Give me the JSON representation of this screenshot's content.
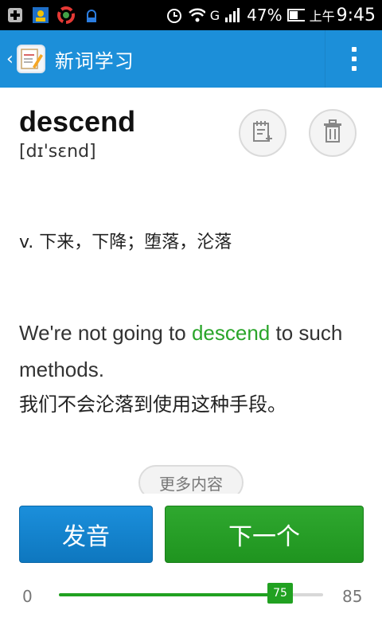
{
  "status_bar": {
    "battery": "47%",
    "time_prefix": "上午",
    "time": "9:45",
    "network": "G"
  },
  "app_bar": {
    "title": "新词学习",
    "color": "#1c8fd9"
  },
  "word": {
    "text": "descend",
    "phonetic": "[dɪ'sɛnd]",
    "definition": "v. 下来，下降；堕落，沦落"
  },
  "example": {
    "before": "We're not going to ",
    "highlight": "descend",
    "after": " to such methods.",
    "translation": "我们不会沦落到使用这种手段。"
  },
  "more_label": "更多内容",
  "actions": {
    "sound_label": "发音",
    "next_label": "下一个"
  },
  "progress": {
    "min_label": "0",
    "max_label": "85",
    "value_label": "75",
    "value": 75,
    "max": 85
  }
}
